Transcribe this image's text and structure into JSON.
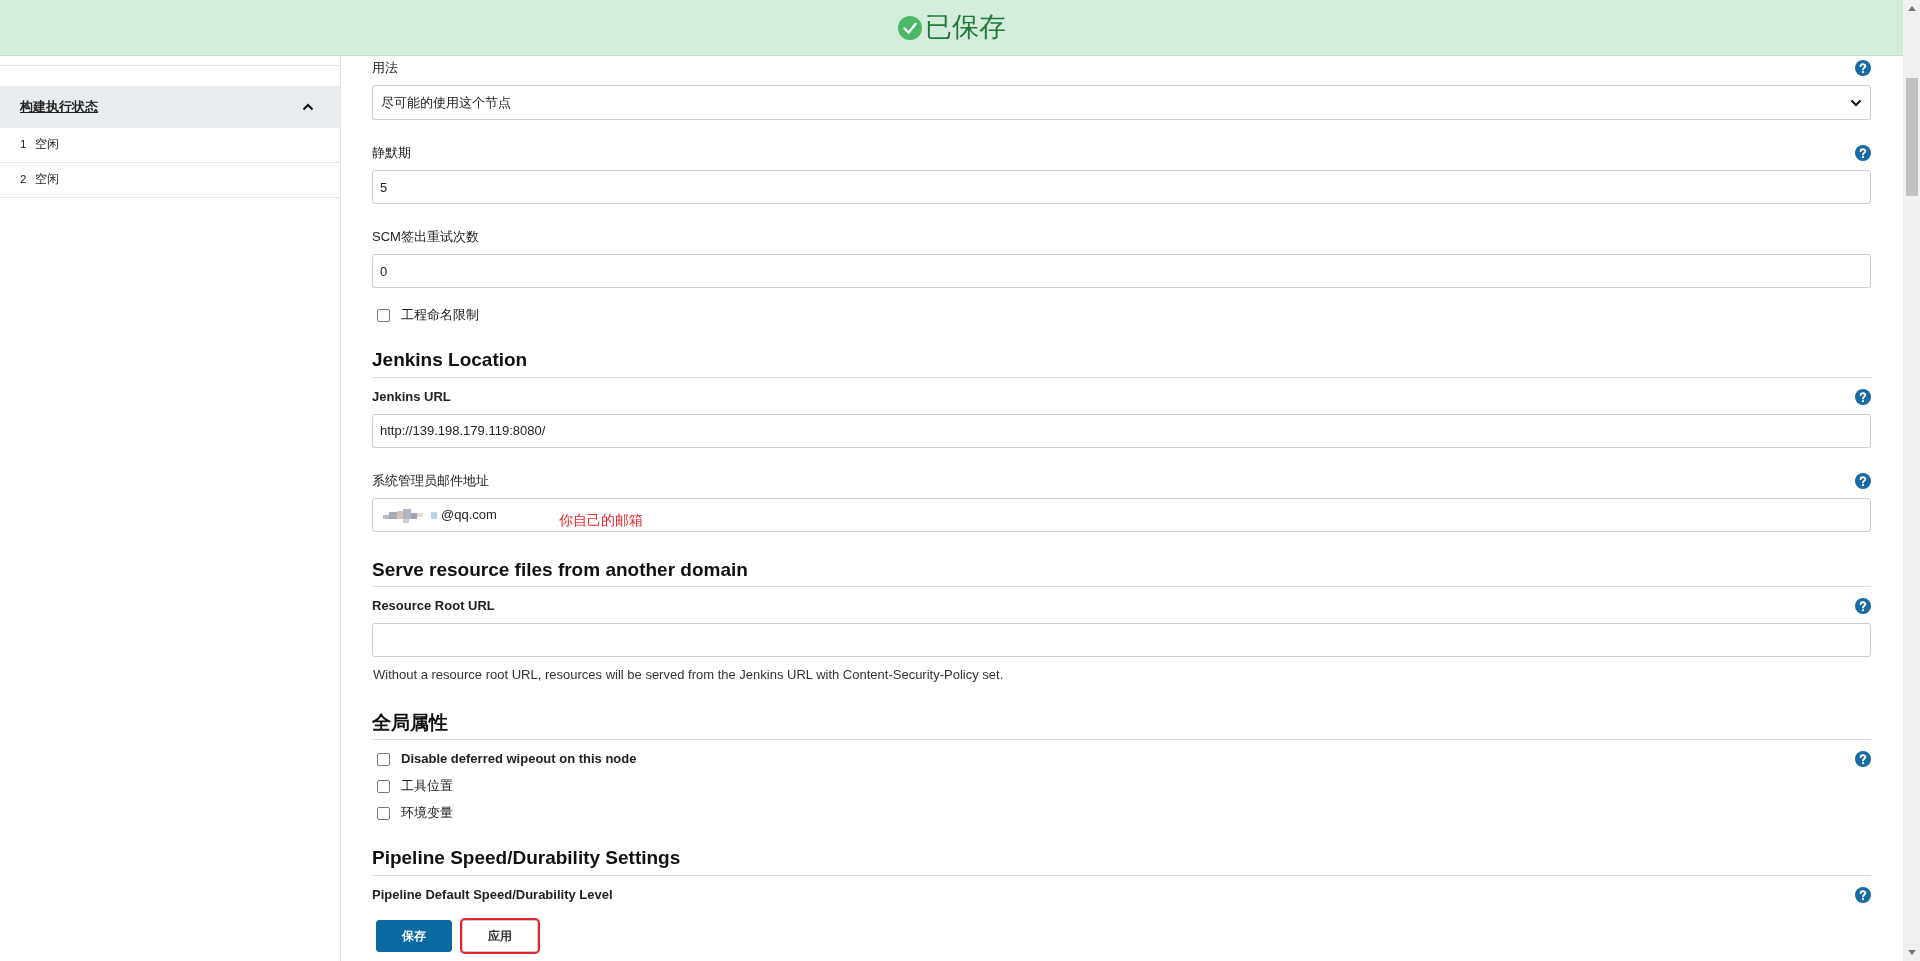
{
  "banner": {
    "text": "已保存"
  },
  "sidebar": {
    "section_title": "构建执行状态",
    "expanded": true,
    "executors": [
      {
        "number": "1",
        "status": "空闲"
      },
      {
        "number": "2",
        "status": "空闲"
      }
    ]
  },
  "form": [
    {
      "kind": "select",
      "label": "用法",
      "value": "尽可能的使用这个节点",
      "help": true
    },
    {
      "kind": "field",
      "label": "静默期",
      "value": "5",
      "help": true
    },
    {
      "kind": "field",
      "label": "SCM签出重试次数",
      "value": "0",
      "help": false
    },
    {
      "kind": "checkbox",
      "label": "工程命名限制",
      "checked": false,
      "help": false
    },
    {
      "kind": "heading",
      "label": "Jenkins Location"
    },
    {
      "kind": "field",
      "label": "Jenkins URL",
      "value": "http://139.198.179.119:8080/",
      "help": true,
      "bold": true
    },
    {
      "kind": "email",
      "label": "系统管理员邮件地址",
      "value": "@qq.com",
      "note": "你自己的邮箱",
      "help": true
    },
    {
      "kind": "heading",
      "label": "Serve resource files from another domain"
    },
    {
      "kind": "field",
      "label": "Resource Root URL",
      "help": true,
      "bold": true,
      "description": "Without a resource root URL, resources will be served from the Jenkins URL with Content-Security-Policy set."
    },
    {
      "kind": "heading",
      "label": "全局属性"
    },
    {
      "kind": "checkbox",
      "label": "Disable deferred wipeout on this node",
      "checked": false,
      "help": true,
      "bold": true
    },
    {
      "kind": "checkbox",
      "label": "工具位置",
      "checked": false,
      "help": false
    },
    {
      "kind": "checkbox",
      "label": "环境变量",
      "checked": false,
      "help": false
    },
    {
      "kind": "heading",
      "label": "Pipeline Speed/Durability Settings"
    },
    {
      "kind": "label",
      "label": "Pipeline Default Speed/Durability Level",
      "help": true,
      "bold": true
    }
  ],
  "buttons": [
    {
      "label": "保存",
      "kind": "primary",
      "highlighted": false
    },
    {
      "label": "应用",
      "kind": "secondary",
      "highlighted": true
    }
  ]
}
